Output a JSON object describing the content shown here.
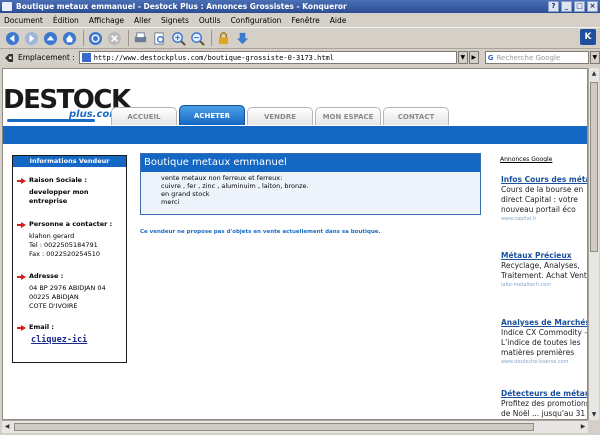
{
  "window": {
    "title": "Boutique metaux emmanuel - Destock Plus : Annonces Grossistes - Konqueror",
    "buttons": [
      "?",
      "_",
      "□",
      "×"
    ]
  },
  "menu": [
    "Document",
    "Édition",
    "Affichage",
    "Aller",
    "Signets",
    "Outils",
    "Configuration",
    "Fenêtre",
    "Aide"
  ],
  "toolbar": {
    "icons": [
      "back-icon",
      "forward-icon",
      "up-icon",
      "home-icon",
      "reload-icon",
      "stop-icon",
      "print-icon",
      "print-preview-icon",
      "zoom-in-icon",
      "zoom-out-icon",
      "security-lock-icon",
      "download-icon"
    ]
  },
  "location": {
    "label": "Emplacement :",
    "url": "http://www.destockplus.com/boutique-grossiste-0-3173.html",
    "search_placeholder": "Recherche Google"
  },
  "site": {
    "logo": "DESTOCK",
    "logo_sub": "plus.com",
    "tabs": [
      {
        "label": "ACCUEIL",
        "active": false
      },
      {
        "label": "ACHETER",
        "active": true
      },
      {
        "label": "VENDRE",
        "active": false
      },
      {
        "label": "MON ESPACE",
        "active": false
      },
      {
        "label": "CONTACT",
        "active": false
      }
    ],
    "accent": "#1467c2"
  },
  "vendor": {
    "header": "Informations Vendeur",
    "raison_label": "Raison Sociale :",
    "raison_value": [
      "developper mon",
      "entreprise"
    ],
    "contact_label": "Personne a contacter :",
    "contact_value": [
      "klahon gerard",
      "Tel : 0022505184791",
      "Fax : 0022520254510"
    ],
    "adresse_label": "Adresse :",
    "adresse_value": [
      "04 BP 2976 ABIDJAN 04",
      "00225 ABIDJAN",
      "COTE D'IVOIRE"
    ],
    "email_label": "Email :",
    "email_link": "cliquez-ici"
  },
  "boutique": {
    "title": "Boutique metaux emmanuel",
    "description": [
      "vente metaux non ferreux et ferreux:",
      "cuivre , fer , zinc , aluminuim , laiton, bronze.",
      "en grand stock",
      "merci"
    ],
    "no_offer": "Ce vendeur ne propose pas d'objets en vente actuellement dans sa boutique."
  },
  "ads": {
    "title": "Annonces Google",
    "items": [
      {
        "title": "Infos Cours des métaux",
        "text": [
          "Cours de la bourse en",
          "direct Capital : votre",
          "nouveau portail éco"
        ],
        "url": "www.capital.fr"
      },
      {
        "title": "Métaux Précieux",
        "text": [
          "Recyclage, Analyses,",
          "Traitement. Achat Vente"
        ],
        "url": "labo-metaltech.com"
      },
      {
        "title": "Analyses de Marchés",
        "text": [
          "Indice CX Commodity -",
          "L'indice de toutes les",
          "matières premières"
        ],
        "url": "www.deutsche-boerse.com"
      },
      {
        "title": "Détecteurs de métaux",
        "text": [
          "Profitez des promotions",
          "de Noël ... jusqu'au 31"
        ],
        "url": ""
      }
    ]
  }
}
